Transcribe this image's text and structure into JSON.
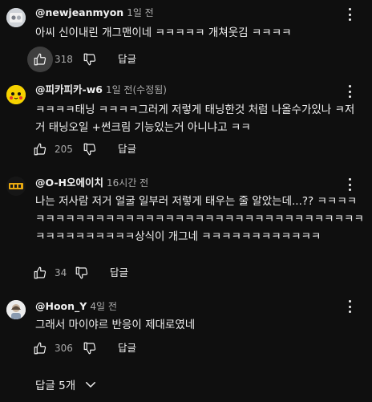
{
  "comments": [
    {
      "author": "@newjeanmyon",
      "time": "1일 전",
      "text": "아씨 신이내린 개그맨이네 ㅋㅋㅋㅋㅋ 개쳐웃김 ㅋㅋㅋㅋ",
      "likes": "318",
      "reply_label": "답글"
    },
    {
      "author": "@피카피카-w6",
      "time": "1일 전(수정됨)",
      "text": "ㅋㅋㅋㅋ태닝 ㅋㅋㅋㅋ그러게 저렇게 태닝한것 처럼  나올수가있나 ㅋ저거 태닝오일 +썬크림 기능있는거 아니냐고 ㅋㅋ",
      "likes": "205",
      "reply_label": "답글"
    },
    {
      "author": "@O-H오에이치",
      "time": "16시간 전",
      "text": "나는 저사람 저거 얼굴 일부러 저렇게 태우는 줄 알았는데...?? ㅋㅋㅋㅋㅋㅋㅋㅋㅋㅋㅋㅋㅋㅋㅋㅋㅋㅋㅋㅋㅋㅋㅋㅋㅋㅋㅋㅋㅋㅋㅋㅋㅋㅋㅋㅋㅋㅋㅋㅋㅋㅋㅋㅋㅋㅋㅋ상식이 개그네 ㅋㅋㅋㅋㅋㅋㅋㅋㅋㅋㅋㅋ",
      "likes": "34",
      "reply_label": "답글"
    },
    {
      "author": "@Hoon_Y",
      "time": "4일 전",
      "text": "그래서 마이야르 반응이 제대로였네",
      "likes": "306",
      "reply_label": "답글"
    }
  ],
  "replies_toggle": {
    "label": "답글 5개"
  },
  "icons": {
    "like": "thumbs-up-icon",
    "dislike": "thumbs-down-icon",
    "more": "more-vert-icon",
    "expand": "chevron-down-icon"
  },
  "colors": {
    "background": "#0f0f0f",
    "text_primary": "#f1f1f1",
    "text_secondary": "#aaaaaa",
    "hover": "#3f3f3f"
  }
}
